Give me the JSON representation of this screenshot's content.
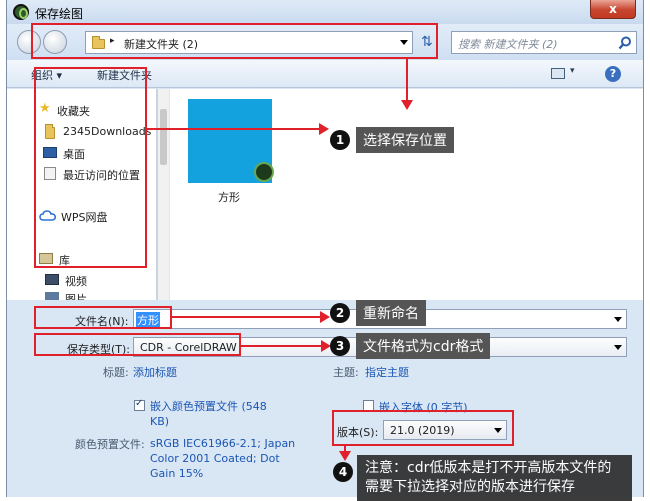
{
  "window": {
    "title": "保存绘图",
    "close": "x"
  },
  "address": {
    "path": "新建文件夹 (2)",
    "separator": "▸"
  },
  "search": {
    "placeholder": "搜索 新建文件夹 (2)"
  },
  "toolbar": {
    "organize": "组织 ▾",
    "new_folder": "新建文件夹"
  },
  "nav": {
    "favorites": "收藏夹",
    "items": [
      "2345Downloads",
      "桌面",
      "最近访问的位置"
    ],
    "wps": "WPS网盘",
    "library": "库",
    "video": "视频",
    "partial": "图片"
  },
  "file": {
    "name": "方形",
    "thumb_color": "#14a2de"
  },
  "form": {
    "filename_label": "文件名(N):",
    "filename_value": "方形",
    "filetype_label": "保存类型(T):",
    "filetype_value": "CDR - CorelDRAW",
    "title_label": "标题:",
    "title_link": "添加标题",
    "subject_label": "主题:",
    "subject_link": "指定主题",
    "embed_profile": "嵌入颜色预置文件 (548 KB)",
    "embed_profile_checked": true,
    "embed_fonts": "嵌入字体 (0 字节)",
    "embed_fonts_checked": false,
    "profile_label": "颜色预置文件:",
    "profile_value": "sRGB IEC61966-2.1; Japan Color 2001 Coated; Dot Gain 15%",
    "version_label": "版本(S):",
    "version_value": "21.0 (2019)"
  },
  "annotations": [
    {
      "num": "1",
      "text": "选择保存位置"
    },
    {
      "num": "2",
      "text": "重新命名"
    },
    {
      "num": "3",
      "text": "文件格式为cdr格式"
    },
    {
      "num": "4",
      "text": "注意：cdr低版本是打不开高版本文件的需要下拉选择对应的版本进行保存"
    }
  ],
  "colors": {
    "annotation_red": "#e0202a",
    "accent_link": "#1a56b3"
  }
}
